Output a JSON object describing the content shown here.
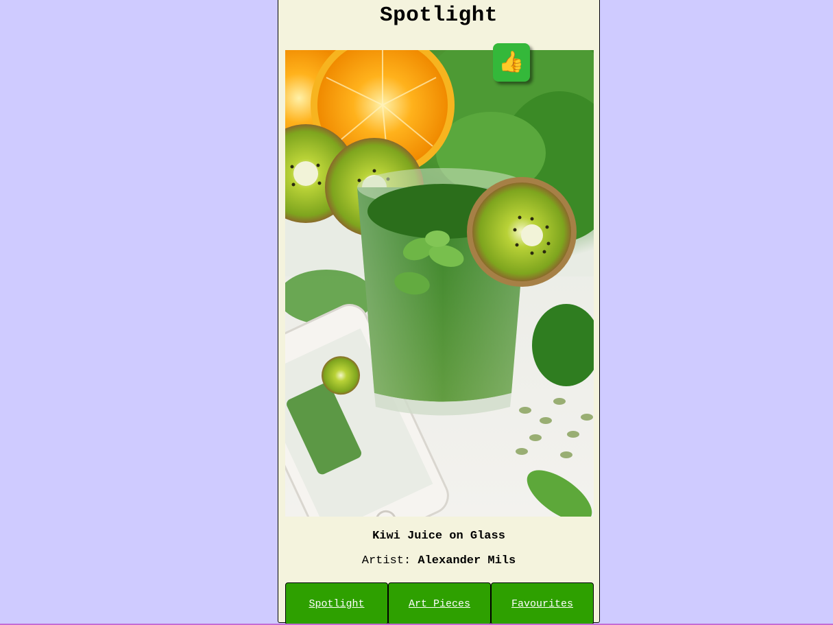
{
  "page": {
    "title": "Spotlight"
  },
  "spotlight": {
    "artwork_alt": "Kiwi Juice on Glass",
    "like_icon": "thumbs-up-icon",
    "title": "Kiwi Juice on Glass",
    "artist_label": "Artist:",
    "artist_name": "Alexander Mils"
  },
  "nav": {
    "items": [
      {
        "label": "Spotlight"
      },
      {
        "label": "Art Pieces"
      },
      {
        "label": "Favourites"
      }
    ]
  },
  "colors": {
    "background": "#cfcbff",
    "card": "#f4f3dd",
    "nav_green": "#2ea000",
    "like_green": "#34b83a"
  }
}
